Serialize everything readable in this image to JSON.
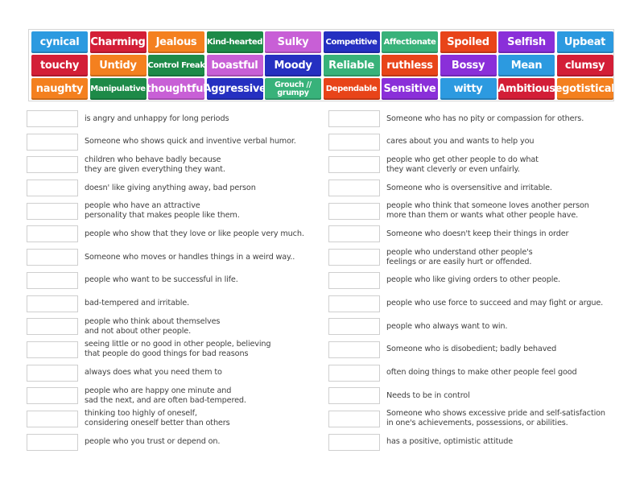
{
  "activity": {
    "tiles": [
      {
        "label": "cynical",
        "color": "blue"
      },
      {
        "label": "Charming",
        "color": "red"
      },
      {
        "label": "Jealous",
        "color": "orange"
      },
      {
        "label": "Kind-hearted",
        "color": "darkgreen",
        "size": "sm"
      },
      {
        "label": "Sulky",
        "color": "pink"
      },
      {
        "label": "Competitive",
        "color": "navy",
        "size": "sm"
      },
      {
        "label": "Affectionate",
        "color": "teal",
        "size": "sm"
      },
      {
        "label": "Spoiled",
        "color": "redorange"
      },
      {
        "label": "Selfish",
        "color": "purple"
      },
      {
        "label": "Upbeat",
        "color": "blue"
      },
      {
        "label": "touchy",
        "color": "red"
      },
      {
        "label": "Untidy",
        "color": "orange"
      },
      {
        "label": "Control Freak",
        "color": "darkgreen",
        "size": "sm"
      },
      {
        "label": "boastful",
        "color": "pink"
      },
      {
        "label": "Moody",
        "color": "navy"
      },
      {
        "label": "Reliable",
        "color": "teal"
      },
      {
        "label": "ruthless",
        "color": "redorange"
      },
      {
        "label": "Bossy",
        "color": "purple"
      },
      {
        "label": "Mean",
        "color": "blue"
      },
      {
        "label": "clumsy",
        "color": "red"
      },
      {
        "label": "naughty",
        "color": "orange"
      },
      {
        "label": "Manipulative",
        "color": "darkgreen",
        "size": "sm"
      },
      {
        "label": "thoughtful",
        "color": "pink"
      },
      {
        "label": "Aggressive",
        "color": "navy"
      },
      {
        "label": "Grouch // grumpy",
        "color": "teal",
        "size": "xs"
      },
      {
        "label": "Dependable",
        "color": "redorange",
        "size": "sm"
      },
      {
        "label": "Sensitive",
        "color": "purple"
      },
      {
        "label": "witty",
        "color": "blue"
      },
      {
        "label": "Ambitious",
        "color": "red"
      },
      {
        "label": "egotistical",
        "color": "orange"
      }
    ],
    "definitions_left": [
      "is angry and unhappy for long periods",
      "Someone who shows quick and inventive verbal humor.",
      "children who behave badly because\nthey are given everything they want.",
      "doesn' like giving anything away, bad person",
      "people who have an attractive\npersonality that makes people like them.",
      "people who show that they love or like people very much.",
      "Someone who moves or handles things in a weird way..",
      "people who want to be successful in life.",
      "bad-tempered and irritable.",
      "people who think about themselves\nand not about other people.",
      "seeing little or no good in other people, believing\nthat people do good things for bad reasons",
      "always does what you need them to",
      "people who are happy one minute and\nsad the next, and are often bad-tempered.",
      "thinking too highly of oneself,\nconsidering oneself better than others",
      "people who you trust or depend on."
    ],
    "definitions_right": [
      "Someone who has no pity or compassion for others.",
      "cares about you and wants to help you",
      "people who get other people to do what\nthey want cleverly or even unfairly.",
      "Someone who is oversensitive and irritable.",
      "people who think that someone loves another person\nmore than them or wants what other people have.",
      "Someone who doesn't keep their things in order",
      "people who understand other people's\nfeelings or are easily hurt or offended.",
      "people who like giving orders to other people.",
      "people who use force to succeed and may fight or argue.",
      "people who always want to win.",
      "Someone who is disobedient; badly behaved",
      "often doing things to make other people feel good",
      "Needs to be in control",
      "Someone who shows excessive pride and self-satisfaction\nin one's achievements, possessions, or abilities.",
      "has a positive, optimistic attitude"
    ]
  },
  "colors": {
    "blue": "#2c9ae0",
    "red": "#d31e37",
    "orange": "#f4801f",
    "darkgreen": "#1d8a48",
    "pink": "#c85fd6",
    "navy": "#2530c1",
    "teal": "#38b27a",
    "redorange": "#e84419",
    "purple": "#8a2fd9"
  }
}
